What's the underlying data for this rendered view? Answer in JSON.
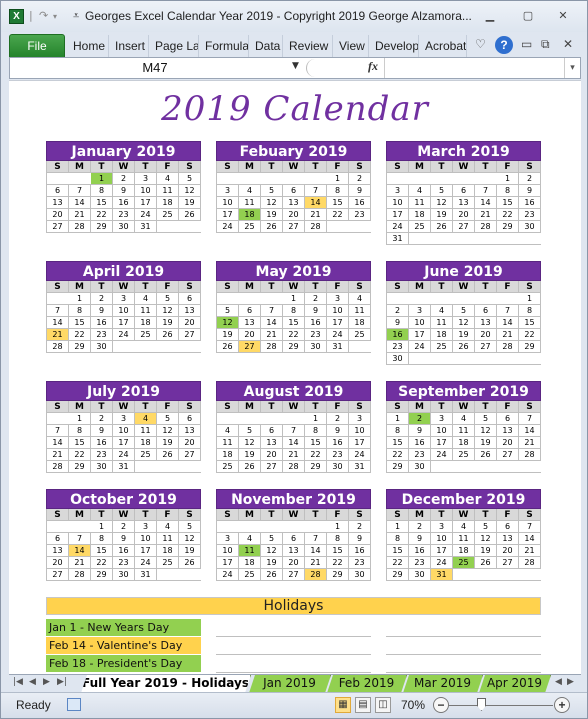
{
  "window": {
    "title": "Georges Excel Calendar Year 2019 - Copyright 2019 George Alzamora...",
    "app_icon": "excel-icon"
  },
  "ribbon": {
    "file_label": "File",
    "tabs": [
      "Home",
      "Insert",
      "Page La",
      "Formula",
      "Data",
      "Review",
      "View",
      "Develop",
      "Acrobat"
    ]
  },
  "formula_bar": {
    "name_box": "M47",
    "formula": ""
  },
  "sheet": {
    "title": "2019 Calendar",
    "day_headers": [
      "S",
      "M",
      "T",
      "W",
      "T",
      "F",
      "S"
    ],
    "months": [
      {
        "name": "January 2019",
        "start": 2,
        "days": 31,
        "green": [
          1
        ],
        "yellow": []
      },
      {
        "name": "Febuary 2019",
        "start": 5,
        "days": 28,
        "green": [
          18
        ],
        "yellow": [
          14
        ]
      },
      {
        "name": "March 2019",
        "start": 5,
        "days": 31,
        "green": [],
        "yellow": []
      },
      {
        "name": "April 2019",
        "start": 1,
        "days": 30,
        "green": [],
        "yellow": [
          21
        ]
      },
      {
        "name": "May 2019",
        "start": 3,
        "days": 31,
        "green": [
          12
        ],
        "yellow": [
          27
        ]
      },
      {
        "name": "June 2019",
        "start": 6,
        "days": 30,
        "green": [
          16
        ],
        "yellow": []
      },
      {
        "name": "July 2019",
        "start": 1,
        "days": 31,
        "green": [],
        "yellow": [
          4
        ]
      },
      {
        "name": "August 2019",
        "start": 4,
        "days": 31,
        "green": [],
        "yellow": []
      },
      {
        "name": "September 2019",
        "start": 0,
        "days": 30,
        "green": [
          2
        ],
        "yellow": []
      },
      {
        "name": "October 2019",
        "start": 2,
        "days": 31,
        "green": [],
        "yellow": [
          14
        ]
      },
      {
        "name": "November 2019",
        "start": 5,
        "days": 30,
        "green": [
          11
        ],
        "yellow": [
          28
        ]
      },
      {
        "name": "December 2019",
        "start": 0,
        "days": 31,
        "green": [
          25
        ],
        "yellow": [
          31
        ]
      }
    ],
    "holidays_title": "Holidays",
    "holidays": [
      {
        "label": "Jan 1 - New Years Day",
        "color": "#92d050"
      },
      {
        "label": "Feb 14 - Valentine's Day",
        "color": "#ffd24d"
      },
      {
        "label": "Feb 18 - President's Day",
        "color": "#92d050"
      }
    ],
    "colors": {
      "header": "#7030a0",
      "green": "#92d050",
      "yellow": "#ffd966"
    }
  },
  "sheet_tabs": {
    "items": [
      "Full Year 2019 - Holidays",
      "Jan 2019",
      "Feb 2019",
      "Mar 2019",
      "Apr 2019"
    ],
    "active": 0
  },
  "status": {
    "ready": "Ready",
    "zoom": "70%"
  }
}
